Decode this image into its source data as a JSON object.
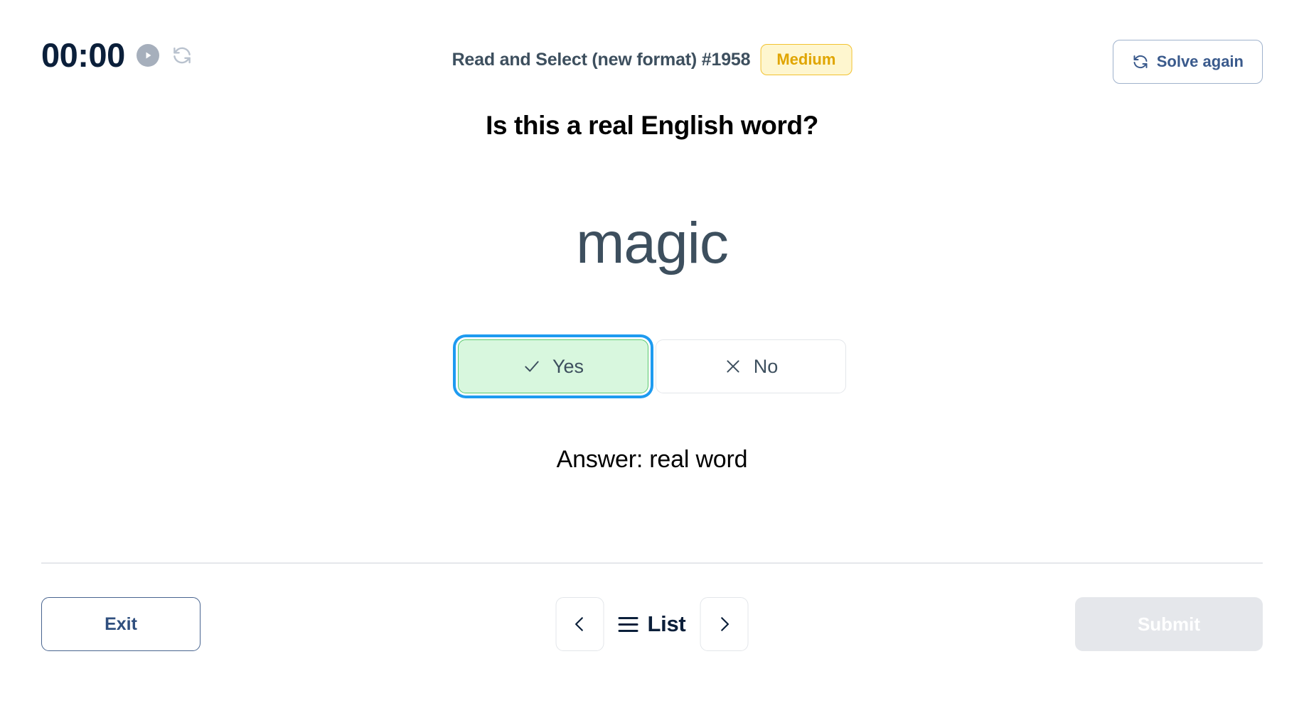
{
  "header": {
    "timer": "00:00",
    "play_icon": "play-icon",
    "reload_icon": "reload-icon",
    "exercise_title": "Read and Select (new format) #1958",
    "difficulty": "Medium",
    "solve_again_label": "Solve again",
    "solve_again_icon": "refresh-icon"
  },
  "main": {
    "question": "Is this a real English word?",
    "word": "magic",
    "choices": [
      {
        "label": "Yes",
        "icon": "check-icon",
        "selected": true
      },
      {
        "label": "No",
        "icon": "close-icon",
        "selected": false
      }
    ],
    "answer": "Answer: real word"
  },
  "footer": {
    "exit_label": "Exit",
    "prev_icon": "chevron-left-icon",
    "next_icon": "chevron-right-icon",
    "list_label": "List",
    "list_icon": "hamburger-icon",
    "submit_label": "Submit"
  },
  "colors": {
    "accent_blue": "#2F4F7E",
    "focus_ring": "#1E9BF0",
    "selected_fill": "#D8F7DE",
    "selected_border": "#5BC96F",
    "badge_bg": "#FEF6CF",
    "badge_border": "#F2C230",
    "badge_text": "#E0A500",
    "timer_text": "#0B1F3A",
    "word_text": "#3D4F5E",
    "disabled_bg": "#E5E7EB"
  }
}
